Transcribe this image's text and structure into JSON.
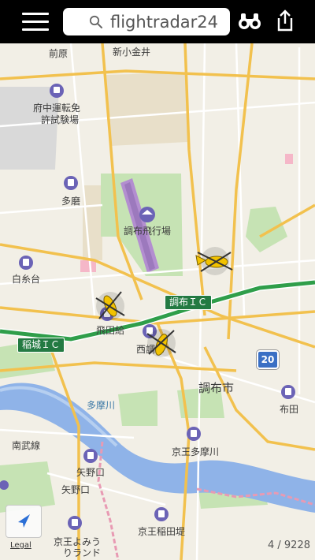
{
  "app": {
    "brand": "flightradar24",
    "menu_icon": "hamburger-menu-icon",
    "search_icon": "magnifier-icon",
    "binoculars_icon": "binoculars-icon",
    "share_icon": "share-icon",
    "colors": {
      "topbar": "#000000",
      "map_bg": "#f2efe6",
      "highway": "#2f9e4a",
      "road_major": "#f2c14e",
      "river": "#8fb3e8",
      "park": "#c6e3b4",
      "aircraft": "#f2c200"
    }
  },
  "map": {
    "places": {
      "maehara": "前原",
      "shinkoganei": "新小金井",
      "fuchu_license": "府中運転免",
      "fuchu_license2": "許試験場",
      "tama": "多磨",
      "chofu_airport": "調布飛行場",
      "shiraitodai": "白糸台",
      "tobitakyu": "飛田給",
      "nishichofu": "西調布",
      "chofu_city": "調布市",
      "fuda": "布田",
      "tamagawa_river": "多摩川",
      "keio_tamagawa": "京王多摩川",
      "minamibu_line": "南武線",
      "yanokuchi_station": "矢野口",
      "yanokuchi": "矢野口",
      "keio_inadazutsumi": "京王稲田堤",
      "keio_yomiuri": "京王よみう",
      "land": "りランド"
    },
    "badges": {
      "chofu_ic": "調布ＩＣ",
      "inagi_ic": "稲城ＩＣ",
      "route_20": "20"
    },
    "aircraft": [
      {
        "name": "aircraft-1",
        "icon": "helicopter-icon"
      },
      {
        "name": "aircraft-2",
        "icon": "helicopter-icon"
      },
      {
        "name": "aircraft-3",
        "icon": "helicopter-icon"
      }
    ]
  },
  "footer": {
    "legal": "Legal",
    "counter": "4 / 9228",
    "location_icon": "location-arrow-icon"
  }
}
